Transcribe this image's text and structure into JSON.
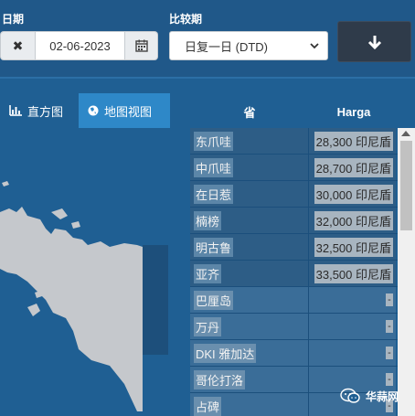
{
  "filters": {
    "date_label": "日期",
    "date_value": "02-06-2023",
    "compare_label": "比较期",
    "compare_value": "日复一日 (DTD)"
  },
  "tabs": [
    {
      "label": "直方图",
      "icon": "bar-chart-icon"
    },
    {
      "label": "地图视图",
      "icon": "globe-icon"
    }
  ],
  "table": {
    "headers": {
      "province": "省",
      "price": "Harga"
    },
    "rows": [
      {
        "province": "东爪哇",
        "price": "28,300 印尼盾"
      },
      {
        "province": "中爪哇",
        "price": "28,700 印尼盾"
      },
      {
        "province": "在日惹",
        "price": "30,000 印尼盾"
      },
      {
        "province": "楠榜",
        "price": "32,000 印尼盾"
      },
      {
        "province": "明古鲁",
        "price": "32,500 印尼盾"
      },
      {
        "province": "亚齐",
        "price": "33,500 印尼盾"
      },
      {
        "province": "巴厘岛",
        "price": "-"
      },
      {
        "province": "万丹",
        "price": "-"
      },
      {
        "province": "DKI 雅加达",
        "price": "-"
      },
      {
        "province": "哥伦打洛",
        "price": "-"
      },
      {
        "province": "占碑",
        "price": "-"
      }
    ]
  },
  "watermark": {
    "text": "华蒜网"
  },
  "colors": {
    "background": "#1f5f93",
    "active_tab": "#2e88c8",
    "map_land": "#c5c8cc",
    "button_dark": "#2f3b4a"
  }
}
